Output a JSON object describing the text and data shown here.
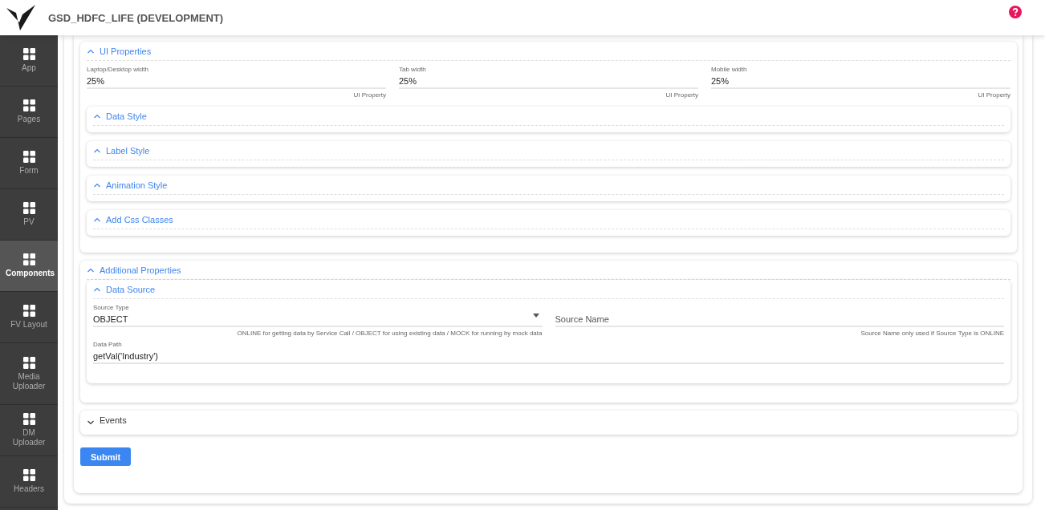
{
  "header": {
    "title": "GSD_HDFC_LIFE (DEVELOPMENT)"
  },
  "sidebar": {
    "items": [
      {
        "label": "App",
        "selected": false
      },
      {
        "label": "Pages",
        "selected": false
      },
      {
        "label": "Form",
        "selected": false
      },
      {
        "label": "PV",
        "selected": false
      },
      {
        "label": "Components",
        "selected": true
      },
      {
        "label": "FV Layout",
        "selected": false
      },
      {
        "label": "Media Uploader",
        "selected": false
      },
      {
        "label": "DM Uploader",
        "selected": false
      },
      {
        "label": "Headers",
        "selected": false
      }
    ]
  },
  "ui_properties": {
    "title": "UI Properties",
    "expanded": true,
    "fields": [
      {
        "label": "Laptop/Desktop width",
        "value": "25%",
        "hint": "UI Property"
      },
      {
        "label": "Tab width",
        "value": "25%",
        "hint": "UI Property"
      },
      {
        "label": "Mobile width",
        "value": "25%",
        "hint": "UI Property"
      }
    ],
    "subsections": [
      {
        "title": "Data Style",
        "expanded": true
      },
      {
        "title": "Label Style",
        "expanded": true
      },
      {
        "title": "Animation Style",
        "expanded": true
      },
      {
        "title": "Add Css Classes",
        "expanded": true
      }
    ]
  },
  "additional_properties": {
    "title": "Additional Properties",
    "expanded": true,
    "data_source": {
      "title": "Data Source",
      "expanded": true,
      "source_type": {
        "label": "Source Type",
        "value": "OBJECT",
        "hint": "ONLINE for getting data by Service Call / OBJECT for using existing data / MOCK for running by mock data"
      },
      "source_name": {
        "placeholder": "Source Name",
        "hint": "Source Name only used if Source Type is ONLINE"
      },
      "data_path": {
        "label": "Data Path",
        "value": "getVal('Industry')"
      }
    }
  },
  "events": {
    "title": "Events",
    "expanded": false
  },
  "submit": {
    "label": "Submit"
  }
}
